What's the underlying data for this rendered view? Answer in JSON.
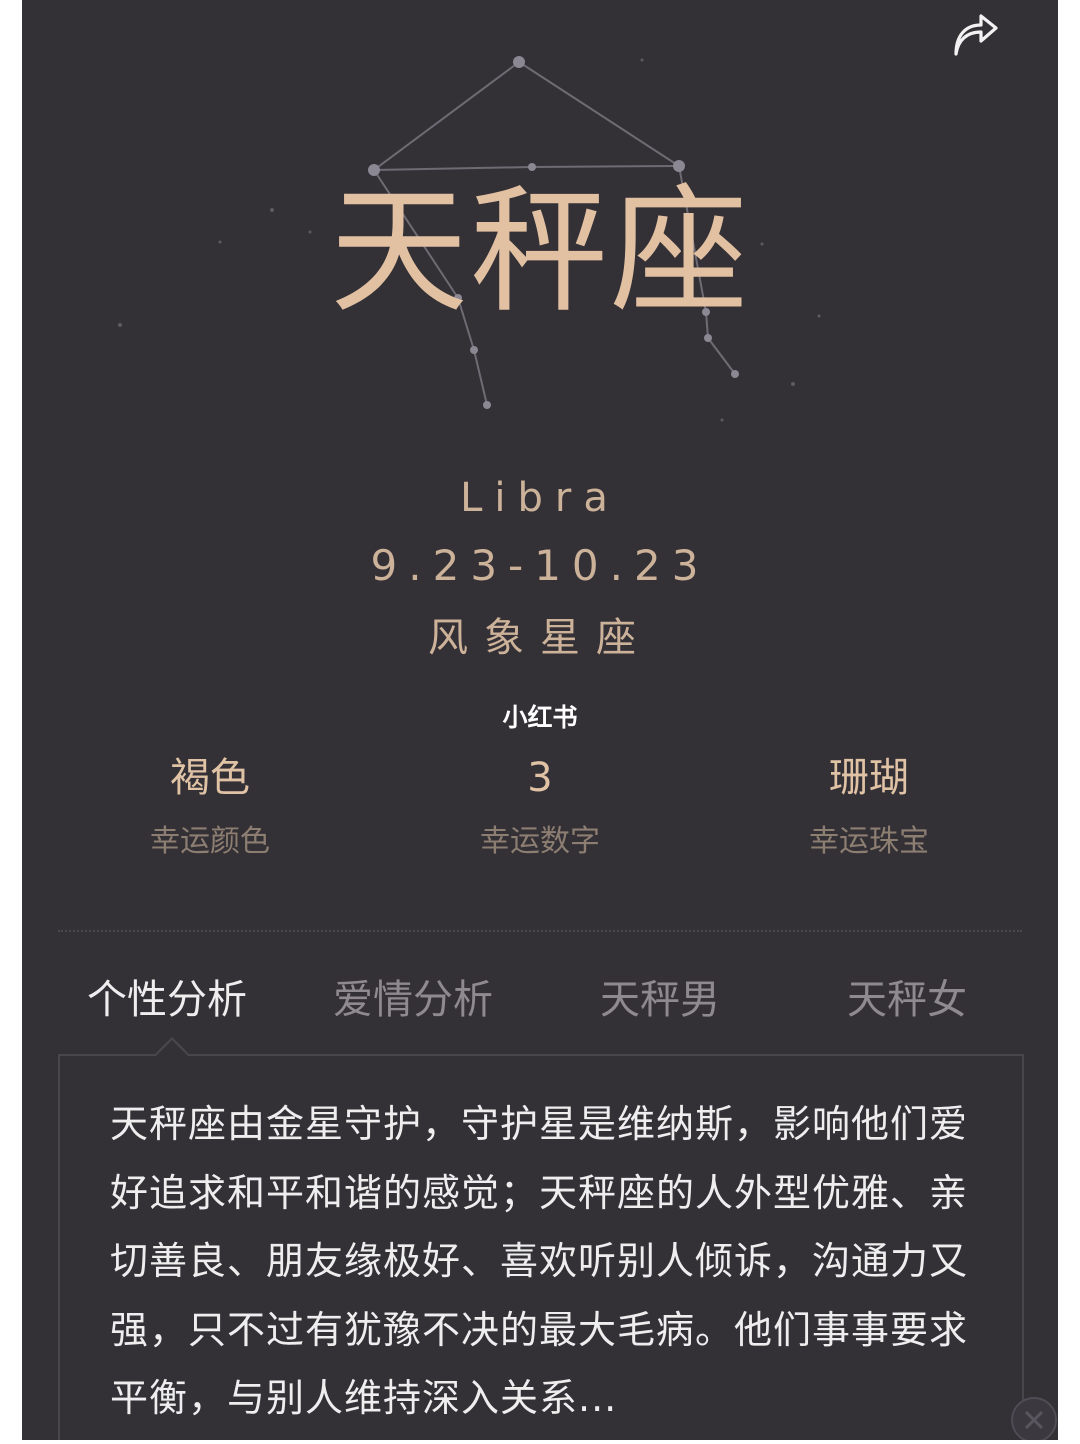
{
  "sign": {
    "name": "天秤座",
    "english": "Libra",
    "dates": "9.23-10.23",
    "element": "风象星座"
  },
  "watermark": "小红书",
  "lucky": {
    "color": {
      "value": "褐色",
      "label": "幸运颜色"
    },
    "number": {
      "value": "3",
      "label": "幸运数字"
    },
    "jewel": {
      "value": "珊瑚",
      "label": "幸运珠宝"
    }
  },
  "tabs": [
    {
      "label": "个性分析",
      "active": true
    },
    {
      "label": "爱情分析",
      "active": false
    },
    {
      "label": "天秤男",
      "active": false
    },
    {
      "label": "天秤女",
      "active": false
    }
  ],
  "description": "天秤座由金星守护，守护星是维纳斯，影响他们爱好追求和平和谐的感觉；天秤座的人外型优雅、亲切善良、朋友缘极好、喜欢听别人倾诉，沟通力又强，只不过有犹豫不决的最大毛病。他们事事要求平衡，与别人维持深入关系...",
  "icons": {
    "share": "share-arrow-icon",
    "close": "close-icon",
    "constellation": "libra-constellation-icon"
  },
  "colors": {
    "background": "#333036",
    "title_gold": "#e2c1a3",
    "subtitle_tan": "#cdb29a",
    "label_muted": "#8d7e72",
    "tab_active": "#eeeeee",
    "tab_inactive": "#8f8a90"
  }
}
